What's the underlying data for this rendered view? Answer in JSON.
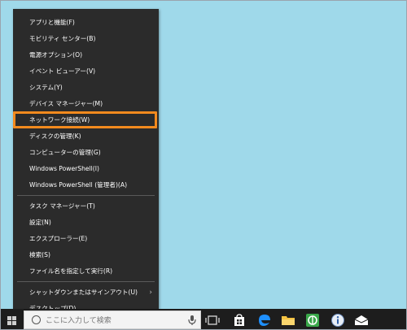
{
  "menu": {
    "items": [
      {
        "label": "アプリと機能(F)"
      },
      {
        "label": "モビリティ センター(B)"
      },
      {
        "label": "電源オプション(O)"
      },
      {
        "label": "イベント ビューアー(V)"
      },
      {
        "label": "システム(Y)"
      },
      {
        "label": "デバイス マネージャー(M)"
      },
      {
        "label": "ネットワーク接続(W)"
      },
      {
        "label": "ディスクの管理(K)"
      },
      {
        "label": "コンピューターの管理(G)"
      },
      {
        "label": "Windows PowerShell(I)"
      },
      {
        "label": "Windows PowerShell (管理者)(A)"
      },
      {
        "label": "タスク マネージャー(T)"
      },
      {
        "label": "設定(N)"
      },
      {
        "label": "エクスプローラー(E)"
      },
      {
        "label": "検索(S)"
      },
      {
        "label": "ファイル名を指定して実行(R)"
      },
      {
        "label": "シャットダウンまたはサインアウト(U)"
      },
      {
        "label": "デスクトップ(D)"
      }
    ],
    "highlighted_label": "ネットワーク接続(W)"
  },
  "taskbar": {
    "search_placeholder": "ここに入力して検索",
    "icons": [
      "microphone-icon",
      "task-view-icon",
      "store-icon",
      "edge-icon",
      "file-explorer-icon",
      "app-icon",
      "info-icon",
      "mail-icon"
    ]
  },
  "colors": {
    "desktop": "#9fd9ea",
    "menu_bg": "#2b2b2b",
    "highlight": "#f28a1e",
    "taskbar": "#1d1d1d"
  }
}
